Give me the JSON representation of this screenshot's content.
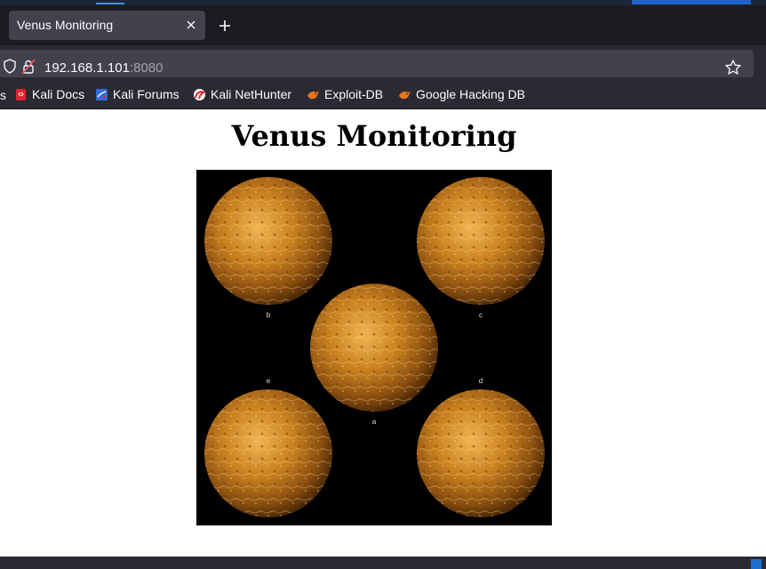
{
  "tab": {
    "title": "Venus Monitoring",
    "close_icon": "close-icon",
    "new_tab_icon": "plus-icon"
  },
  "address_bar": {
    "host": "192.168.1.101",
    "port": ":8080",
    "security_icon": "shield-icon",
    "insecure_icon": "lock-insecure-icon",
    "bookmark_icon": "star-icon"
  },
  "bookmarks": {
    "cut_item": "s",
    "items": [
      {
        "label": "Kali Docs",
        "icon": "kali-docs-icon"
      },
      {
        "label": "Kali Forums",
        "icon": "kali-forums-icon"
      },
      {
        "label": "Kali NetHunter",
        "icon": "nethunter-icon"
      },
      {
        "label": "Exploit-DB",
        "icon": "exploit-db-icon"
      },
      {
        "label": "Google Hacking DB",
        "icon": "ghdb-icon"
      }
    ]
  },
  "page": {
    "heading": "Venus Monitoring",
    "image": {
      "panels": [
        {
          "label": "b"
        },
        {
          "label": "c"
        },
        {
          "label": "a"
        },
        {
          "label": "e"
        },
        {
          "label": "d"
        }
      ]
    }
  },
  "colors": {
    "tab_bar": "#1c1b22",
    "toolbar": "#2b2a33",
    "tab_active": "#42414d",
    "url_field": "#42414d",
    "text_light": "#fbfbfe",
    "text_dim": "#a3a3aa",
    "venus_orange": "#d08a2a"
  }
}
